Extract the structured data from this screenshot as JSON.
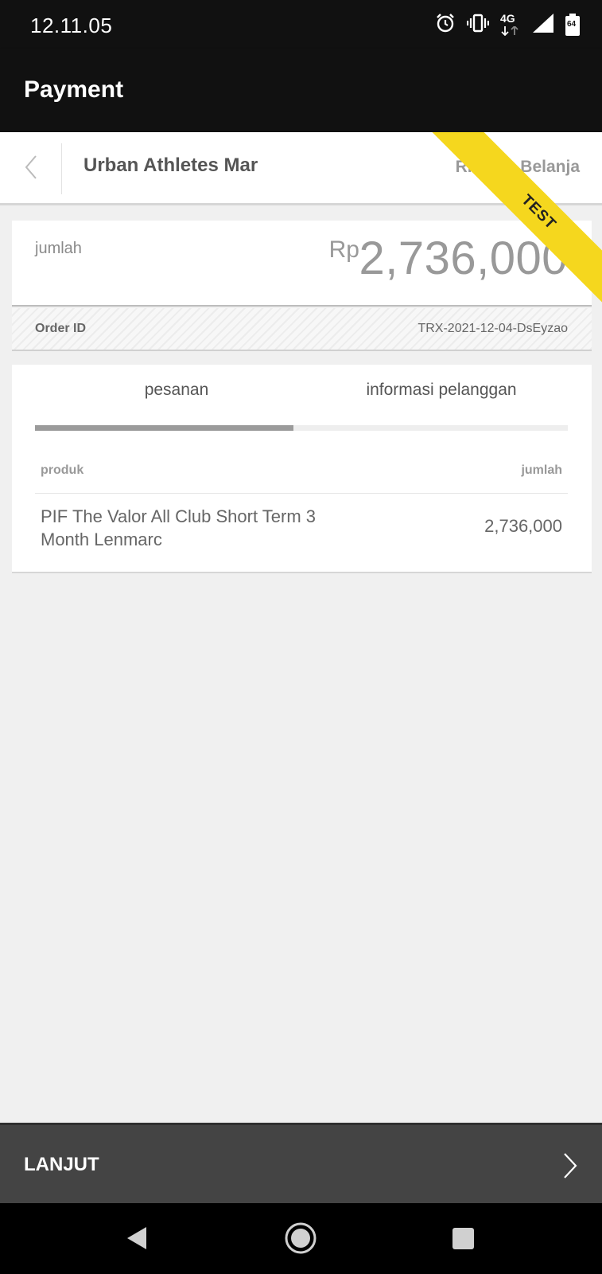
{
  "status_bar": {
    "time": "12.11.05",
    "network": "4G",
    "battery": "64",
    "icons": [
      "alarm-icon",
      "vibrate-icon",
      "network-4g-icon",
      "signal-icon",
      "battery-icon"
    ]
  },
  "app_bar": {
    "title": "Payment"
  },
  "merchant": {
    "name": "Urban Athletes Mar",
    "detail_link": "Rincian Belanja",
    "ribbon": "TEST"
  },
  "amount": {
    "label": "jumlah",
    "currency": "Rp",
    "value": "2,736,000"
  },
  "order": {
    "label": "Order ID",
    "value": "TRX-2021-12-04-DsEyzao"
  },
  "tabs": [
    {
      "label": "pesanan",
      "active": true
    },
    {
      "label": "informasi pelanggan",
      "active": false
    }
  ],
  "table": {
    "headers": {
      "product": "produk",
      "amount": "jumlah"
    },
    "rows": [
      {
        "product": "PIF The Valor All Club Short Term 3 Month Lenmarc",
        "amount": "2,736,000"
      }
    ]
  },
  "footer": {
    "continue_label": "LANJUT"
  },
  "colors": {
    "ribbon": "#f5d71e",
    "app_bar": "#111111",
    "continue_bar": "#444444"
  }
}
